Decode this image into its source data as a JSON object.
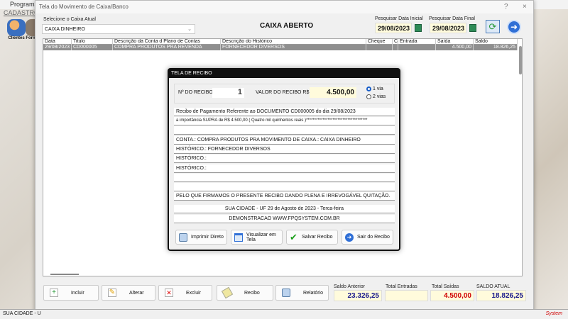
{
  "app": {
    "title": "Programa C",
    "menu": "CADASTROS",
    "toolbar": [
      {
        "label": "Clientes"
      },
      {
        "label": "Forn"
      }
    ],
    "status_left": "SUA CIDADE - U",
    "status_right": "System"
  },
  "window": {
    "title": "Tela do Movimento de Caixa/Banco",
    "help": "?",
    "close": "×"
  },
  "filters": {
    "caixa_label": "Selecione o Caixa Atual",
    "caixa_value": "CAIXA DINHEIRO",
    "status": "CAIXA ABERTO",
    "data_inicial_label": "Pesquisar Data Inicial",
    "data_inicial": "29/08/2023",
    "data_final_label": "Pesquisar Data Final",
    "data_final": "29/08/2023"
  },
  "grid": {
    "columns": [
      "Data",
      "Titulo",
      "Descrição da Conta d Plano de Contas",
      "Descrição do Histórico",
      "Cheque",
      "C",
      "Entrada",
      "Saída",
      "Saldo"
    ],
    "rows": [
      [
        "29/08/2023",
        "CD000005",
        "COMPRA PRODUTOS PRA REVENDA",
        "FORNECEDOR DIVERSOS",
        "",
        "",
        "",
        "4.500,00",
        "18.826,25"
      ]
    ]
  },
  "receipt": {
    "title": "TELA DE RECIBO",
    "numero_label": "Nº DO RECIBO",
    "numero": "1",
    "valor_label": "VALOR DO RECIBO R$",
    "valor": "4.500,00",
    "via1": "1 via",
    "via2": "2 vias",
    "lines": [
      "Recibo de Pagamento Referente ao DOCUMENTO CD000005    do dia 29/08/2023",
      "a importância SUPRA de R$    4.500,00 ( Quatro mil quinhentos reais )*************************************",
      "",
      "CONTA.: COMPRA PRODUTOS PRA  MOVIMENTO DE CAIXA.: CAIXA DINHEIRO",
      "HISTÓRICO.: FORNECEDOR DIVERSOS",
      "HISTÓRICO.:",
      "HISTÓRICO.:",
      "",
      "",
      "PELO QUE FIRMAMOS O PRESENTE RECIBO DANDO PLENA E IRREVOGÁVEL QUITAÇÃO."
    ],
    "cidade": "SUA CIDADE - UF 29 de Agosto de 2023 - Terca-feira",
    "demo": "DEMONSTRACAO WWW.FPQSYSTEM.COM.BR",
    "buttons": {
      "imprimir": "Imprimir Direto",
      "visualizar": "Visualizar em Tela",
      "salvar": "Salvar Recibo",
      "sair": "Sair do Recibo"
    }
  },
  "actions": {
    "incluir": "Incluir",
    "alterar": "Alterar",
    "excluir": "Excluir",
    "recibo": "Recibo",
    "relatorio": "Relatório"
  },
  "totals": {
    "saldo_anterior_label": "Saldo Anterior",
    "saldo_anterior": "23.326,25",
    "entradas_label": "Total Entradas",
    "entradas": "",
    "saidas_label": "Total Saídas",
    "saidas": "4.500,00",
    "saldo_atual_label": "SALDO ATUAL",
    "saldo_atual": "18.826,25"
  },
  "colors": {
    "blue_value": "#1a1a8c",
    "red_value": "#d00000",
    "field_bg": "#fffbdc"
  }
}
